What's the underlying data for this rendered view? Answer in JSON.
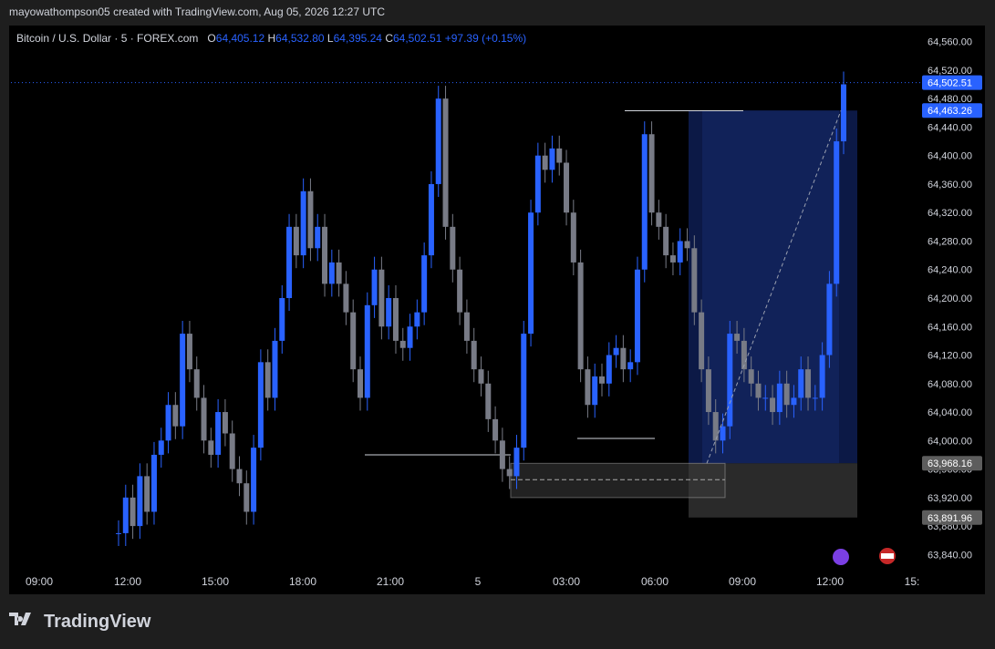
{
  "header": {
    "credit": "mayowathompson05 created with TradingView.com, Aug 05, 2026 12:27 UTC"
  },
  "symbol": {
    "name": "Bitcoin / U.S. Dollar · 5 · FOREX.com",
    "o_label": "O",
    "o_value": "64,405.12",
    "h_label": "H",
    "h_value": "64,532.80",
    "l_label": "L",
    "l_value": "64,395.24",
    "c_label": "C",
    "c_value": "64,502.51",
    "change": "+97.39 (+0.15%)"
  },
  "footer": {
    "brand": "TradingView"
  },
  "colors": {
    "background": "#000000",
    "up": "#2962ff",
    "down": "#787b86",
    "position": "#0d1a4a",
    "stop": "#2a2a2a"
  },
  "chart_data": {
    "type": "candlestick",
    "title": "Bitcoin / U.S. Dollar · 5 · FOREX.com",
    "y_ticks": [
      "64,560.00",
      "64,520.00",
      "64,480.00",
      "64,440.00",
      "64,400.00",
      "64,360.00",
      "64,320.00",
      "64,280.00",
      "64,240.00",
      "64,200.00",
      "64,160.00",
      "64,120.00",
      "64,080.00",
      "64,040.00",
      "64,000.00",
      "63,960.00",
      "63,920.00",
      "63,880.00",
      "63,840.00"
    ],
    "y_tick_values": [
      64560,
      64520,
      64480,
      64440,
      64400,
      64360,
      64320,
      64280,
      64240,
      64200,
      64160,
      64120,
      64080,
      64040,
      64000,
      63960,
      63920,
      63880,
      63840
    ],
    "ylim": [
      63820,
      64580
    ],
    "x_ticks": [
      "09:00",
      "12:00",
      "15:00",
      "18:00",
      "21:00",
      "5",
      "03:00",
      "06:00",
      "09:00",
      "12:00",
      "15:"
    ],
    "price_labels": [
      {
        "text": "64,502.51",
        "value": 64502.51,
        "style": "blue"
      },
      {
        "text": "64,463.26",
        "value": 64463.26,
        "style": "blue"
      },
      {
        "text": "63,968.16",
        "value": 63968.16,
        "style": "gray"
      },
      {
        "text": "63,891.96",
        "value": 63891.96,
        "style": "gray"
      }
    ],
    "last_price": 64502.51,
    "position": {
      "entry": 63968.16,
      "target": 64463.26,
      "stop": 63891.96
    },
    "series": [
      {
        "values": [
          63870,
          63920,
          63880,
          63950,
          63900,
          63980,
          64000,
          64050,
          64020,
          64150,
          64100,
          64060,
          64000,
          63980,
          64040,
          64010,
          63960,
          63940,
          63900,
          63990,
          64110,
          64060,
          64140,
          64200,
          64300,
          64260,
          64350,
          64270,
          64300,
          64220,
          64250,
          64220,
          64180,
          64100,
          64060,
          64190,
          64240,
          64160,
          64200,
          64140,
          64130,
          64160,
          64180,
          64260,
          64360,
          64480,
          64300,
          64240,
          64180,
          64140,
          64100,
          64080,
          64030,
          64000,
          63960,
          63950,
          63990,
          64150,
          64320,
          64400,
          64380,
          64410,
          64390,
          64320,
          64250,
          64100,
          64050,
          64090,
          64080,
          64120,
          64130,
          64100,
          64110,
          64240,
          64430,
          64320,
          64300,
          64260,
          64250,
          64280,
          64270,
          64180,
          64100,
          64040,
          64000,
          64020,
          64150,
          64140,
          64100,
          64080,
          64060,
          64060,
          64040,
          64080,
          64050,
          64060,
          64100,
          64060,
          64060,
          64120,
          64220,
          64420,
          64500
        ]
      }
    ]
  }
}
